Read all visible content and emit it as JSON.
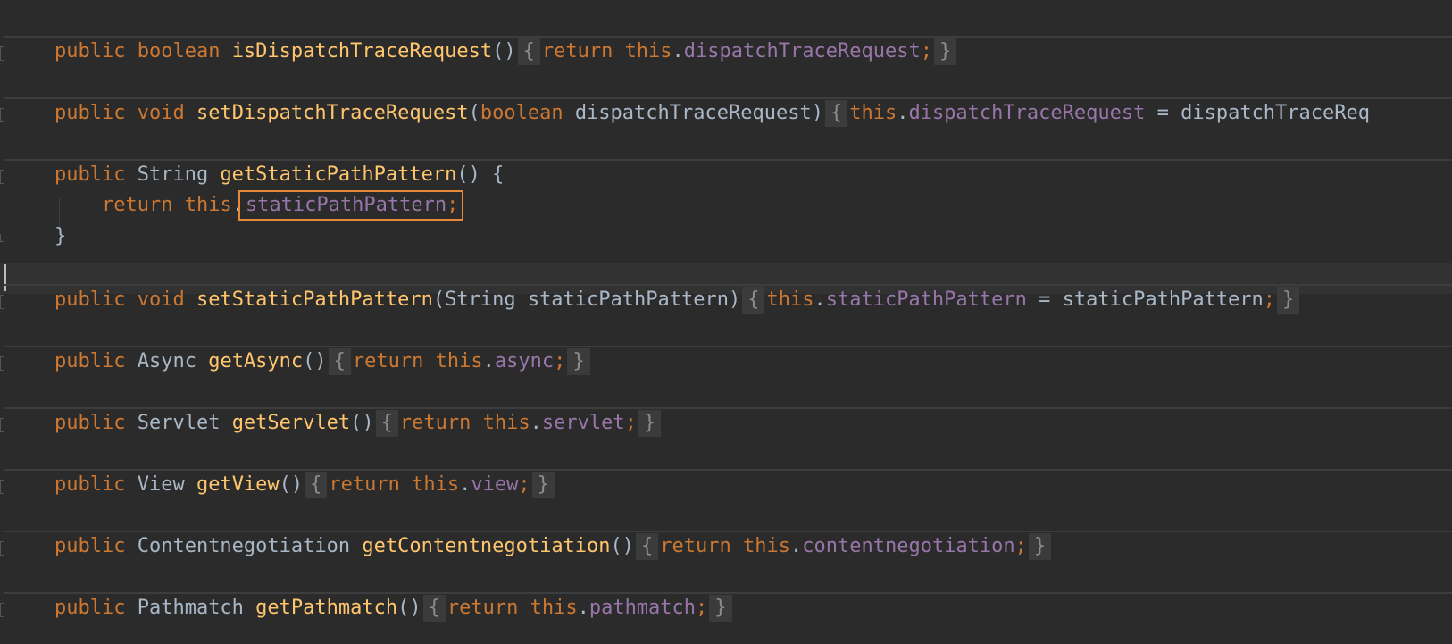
{
  "editor": {
    "lines": [
      {
        "kind": "folded",
        "parts": [
          {
            "t": "public ",
            "c": "kw"
          },
          {
            "t": "boolean ",
            "c": "kw"
          },
          {
            "t": "isDispatchTraceRequest",
            "c": "fn"
          },
          {
            "t": "()",
            "c": "plain"
          },
          {
            "t": "{",
            "c": "fold"
          },
          {
            "t": "return ",
            "c": "kw"
          },
          {
            "t": "this",
            "c": "kw"
          },
          {
            "t": ".",
            "c": "plain"
          },
          {
            "t": "dispatchTraceRequest",
            "c": "field"
          },
          {
            "t": ";",
            "c": "semi"
          },
          {
            "t": "}",
            "c": "fold"
          }
        ]
      },
      {
        "kind": "folded",
        "parts": [
          {
            "t": "public ",
            "c": "kw"
          },
          {
            "t": "void ",
            "c": "kw"
          },
          {
            "t": "setDispatchTraceRequest",
            "c": "fn"
          },
          {
            "t": "(",
            "c": "plain"
          },
          {
            "t": "boolean ",
            "c": "kw"
          },
          {
            "t": "dispatchTraceRequest)",
            "c": "plain"
          },
          {
            "t": "{",
            "c": "fold"
          },
          {
            "t": "this",
            "c": "kw"
          },
          {
            "t": ".",
            "c": "plain"
          },
          {
            "t": "dispatchTraceRequest",
            "c": "field"
          },
          {
            "t": " = dispatchTraceReq",
            "c": "plain"
          }
        ]
      },
      {
        "kind": "open",
        "parts": [
          {
            "t": "public ",
            "c": "kw"
          },
          {
            "t": "String ",
            "c": "plain"
          },
          {
            "t": "getStaticPathPattern",
            "c": "fn"
          },
          {
            "t": "() {",
            "c": "plain"
          }
        ]
      },
      {
        "kind": "body",
        "parts": [
          {
            "t": "    return ",
            "c": "kw"
          },
          {
            "t": "this",
            "c": "kw"
          },
          {
            "t": ".",
            "c": "plain"
          },
          {
            "t": "staticPathPattern",
            "c": "field",
            "box": true
          },
          {
            "t": ";",
            "c": "semi",
            "box": true
          }
        ]
      },
      {
        "kind": "close",
        "parts": [
          {
            "t": "}",
            "c": "plain"
          }
        ]
      },
      {
        "kind": "folded",
        "parts": [
          {
            "t": "public ",
            "c": "kw"
          },
          {
            "t": "void ",
            "c": "kw"
          },
          {
            "t": "setStaticPathPattern",
            "c": "fn"
          },
          {
            "t": "(String staticPathPattern)",
            "c": "plain"
          },
          {
            "t": "{",
            "c": "fold"
          },
          {
            "t": "this",
            "c": "kw"
          },
          {
            "t": ".",
            "c": "plain"
          },
          {
            "t": "staticPathPattern",
            "c": "field"
          },
          {
            "t": " = staticPathPattern",
            "c": "plain"
          },
          {
            "t": ";",
            "c": "semi"
          },
          {
            "t": "}",
            "c": "fold"
          }
        ]
      },
      {
        "kind": "folded",
        "parts": [
          {
            "t": "public ",
            "c": "kw"
          },
          {
            "t": "Async ",
            "c": "plain"
          },
          {
            "t": "getAsync",
            "c": "fn"
          },
          {
            "t": "()",
            "c": "plain"
          },
          {
            "t": "{",
            "c": "fold"
          },
          {
            "t": "return ",
            "c": "kw"
          },
          {
            "t": "this",
            "c": "kw"
          },
          {
            "t": ".",
            "c": "plain"
          },
          {
            "t": "async",
            "c": "field"
          },
          {
            "t": ";",
            "c": "semi"
          },
          {
            "t": "}",
            "c": "fold"
          }
        ]
      },
      {
        "kind": "folded",
        "parts": [
          {
            "t": "public ",
            "c": "kw"
          },
          {
            "t": "Servlet ",
            "c": "plain"
          },
          {
            "t": "getServlet",
            "c": "fn"
          },
          {
            "t": "()",
            "c": "plain"
          },
          {
            "t": "{",
            "c": "fold"
          },
          {
            "t": "return ",
            "c": "kw"
          },
          {
            "t": "this",
            "c": "kw"
          },
          {
            "t": ".",
            "c": "plain"
          },
          {
            "t": "servlet",
            "c": "field"
          },
          {
            "t": ";",
            "c": "semi"
          },
          {
            "t": "}",
            "c": "fold"
          }
        ]
      },
      {
        "kind": "folded",
        "parts": [
          {
            "t": "public ",
            "c": "kw"
          },
          {
            "t": "View ",
            "c": "plain"
          },
          {
            "t": "getView",
            "c": "fn"
          },
          {
            "t": "()",
            "c": "plain"
          },
          {
            "t": "{",
            "c": "fold"
          },
          {
            "t": "return ",
            "c": "kw"
          },
          {
            "t": "this",
            "c": "kw"
          },
          {
            "t": ".",
            "c": "plain"
          },
          {
            "t": "view",
            "c": "field"
          },
          {
            "t": ";",
            "c": "semi"
          },
          {
            "t": "}",
            "c": "fold"
          }
        ]
      },
      {
        "kind": "folded",
        "parts": [
          {
            "t": "public ",
            "c": "kw"
          },
          {
            "t": "Contentnegotiation ",
            "c": "plain"
          },
          {
            "t": "getContentnegotiation",
            "c": "fn"
          },
          {
            "t": "()",
            "c": "plain"
          },
          {
            "t": "{",
            "c": "fold"
          },
          {
            "t": "return ",
            "c": "kw"
          },
          {
            "t": "this",
            "c": "kw"
          },
          {
            "t": ".",
            "c": "plain"
          },
          {
            "t": "contentnegotiation",
            "c": "field"
          },
          {
            "t": ";",
            "c": "semi"
          },
          {
            "t": "}",
            "c": "fold"
          }
        ]
      },
      {
        "kind": "folded",
        "parts": [
          {
            "t": "public ",
            "c": "kw"
          },
          {
            "t": "Pathmatch ",
            "c": "plain"
          },
          {
            "t": "getPathmatch",
            "c": "fn"
          },
          {
            "t": "()",
            "c": "plain"
          },
          {
            "t": "{",
            "c": "fold"
          },
          {
            "t": "return ",
            "c": "kw"
          },
          {
            "t": "this",
            "c": "kw"
          },
          {
            "t": ".",
            "c": "plain"
          },
          {
            "t": "pathmatch",
            "c": "field"
          },
          {
            "t": ";",
            "c": "semi"
          },
          {
            "t": "}",
            "c": "fold"
          }
        ]
      }
    ]
  },
  "colors": {
    "background": "#2b2b2b",
    "keyword": "#cc7832",
    "function": "#ffc66d",
    "field": "#9876aa",
    "plain": "#a9b7c6",
    "highlight_border": "#e8893a"
  }
}
